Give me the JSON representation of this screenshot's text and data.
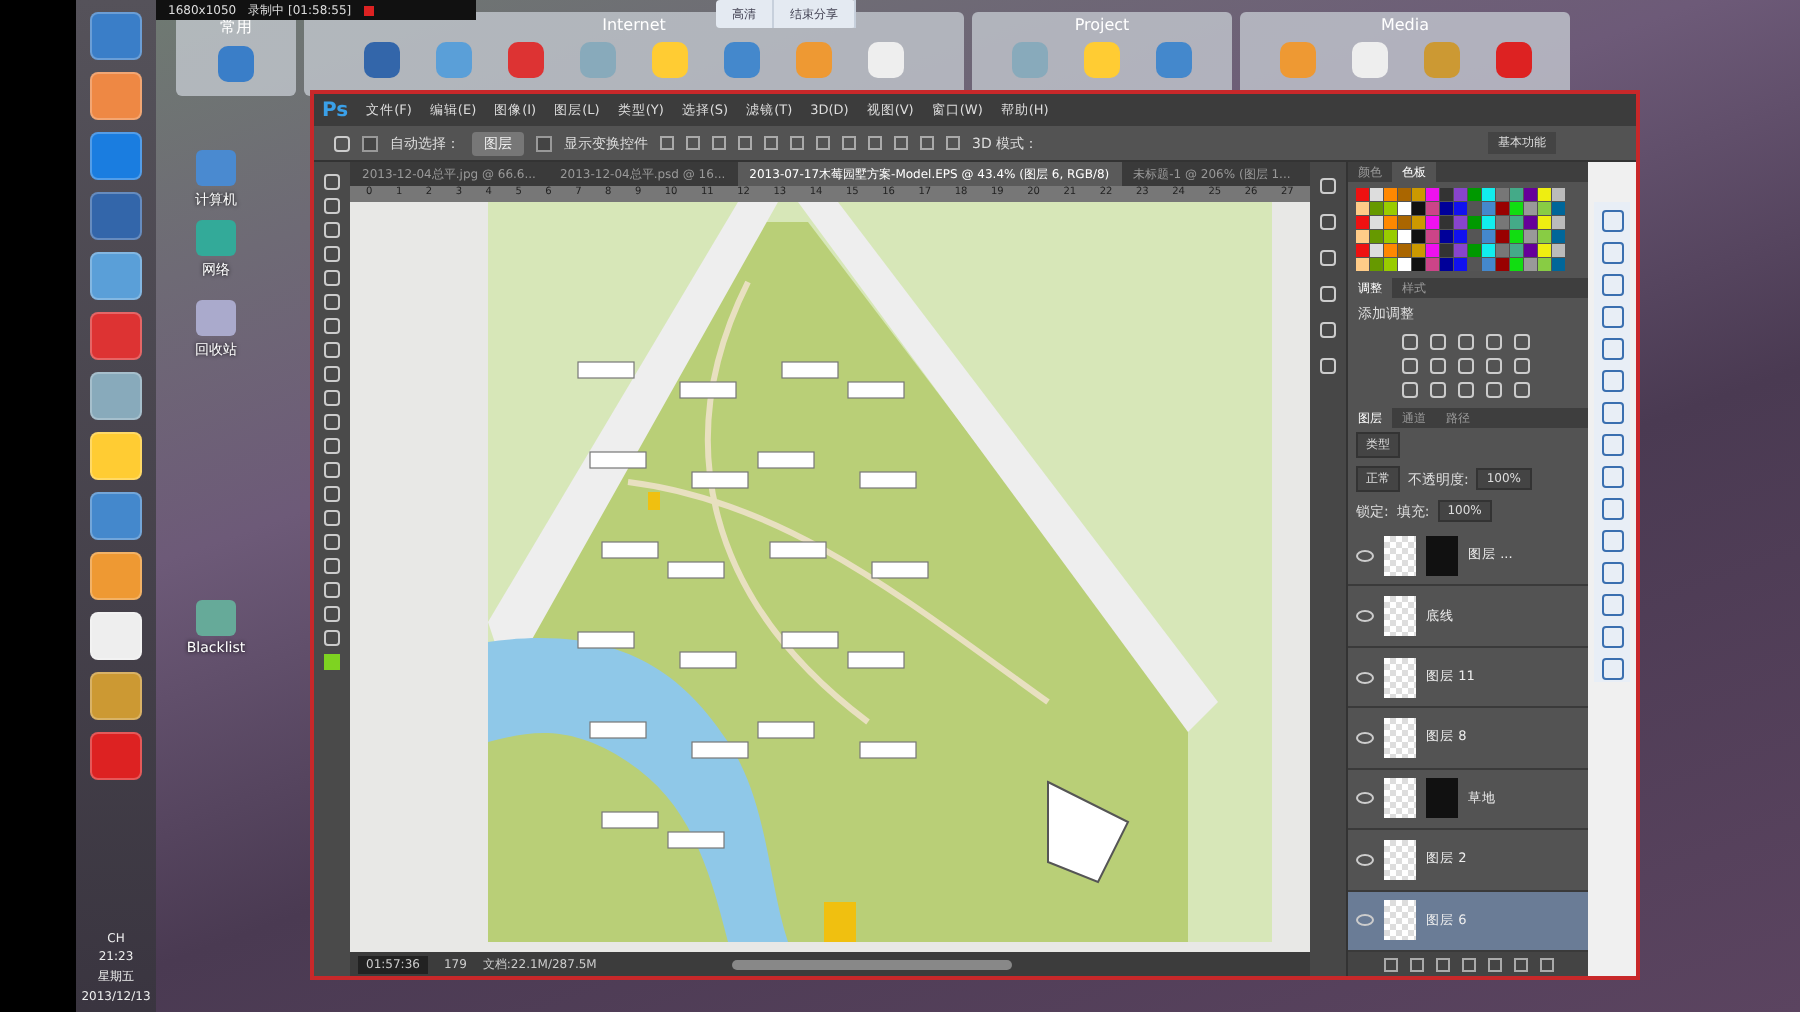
{
  "recorder": {
    "resolution": "1680x1050",
    "status": "录制中 [01:58:55]"
  },
  "share_bar": {
    "buttons": [
      "高清",
      "结束分享"
    ]
  },
  "launcher": {
    "groups": [
      {
        "title": "常用"
      },
      {
        "title": "Internet"
      },
      {
        "title": "Project"
      },
      {
        "title": "Media"
      }
    ]
  },
  "desktop_icons": [
    {
      "label": "计算机"
    },
    {
      "label": "网络"
    },
    {
      "label": "回收站"
    },
    {
      "label": "Blacklist"
    }
  ],
  "taskbar": {
    "language": "CH",
    "time": "21:23",
    "weekday": "星期五",
    "date": "2013/12/13"
  },
  "photoshop": {
    "logo": "Ps",
    "menu": [
      "文件(F)",
      "编辑(E)",
      "图像(I)",
      "图层(L)",
      "类型(Y)",
      "选择(S)",
      "滤镜(T)",
      "3D(D)",
      "视图(V)",
      "窗口(W)",
      "帮助(H)"
    ],
    "options": {
      "auto_select": {
        "label": "自动选择：",
        "checked": false
      },
      "target": "图层",
      "show_transform": {
        "label": "显示变换控件",
        "checked": false
      },
      "mode_3d": "3D 模式：",
      "workspace": "基本功能"
    },
    "tabs": [
      {
        "label": "2013-12-04总平.jpg @ 66.6...",
        "selected": false
      },
      {
        "label": "2013-12-04总平.psd @ 16...",
        "selected": false
      },
      {
        "label": "2013-07-17木莓园墅方案-Model.EPS @ 43.4% (图层 6, RGB/8)",
        "selected": true
      },
      {
        "label": "未标题-1 @ 206% (图层 1...",
        "selected": false
      }
    ],
    "ruler": [
      "0",
      "1",
      "2",
      "3",
      "4",
      "5",
      "6",
      "7",
      "8",
      "9",
      "10",
      "11",
      "12",
      "13",
      "14",
      "15",
      "16",
      "17",
      "18",
      "19",
      "20",
      "21",
      "22",
      "23",
      "24",
      "25",
      "26",
      "27"
    ],
    "swatches_panel": {
      "tabs": [
        {
          "label": "颜色",
          "selected": false
        },
        {
          "label": "色板",
          "selected": true
        }
      ]
    },
    "adjustments_panel": {
      "tabs": [
        {
          "label": "调整",
          "selected": true
        },
        {
          "label": "样式",
          "selected": false
        }
      ],
      "heading": "添加调整"
    },
    "layers_panel": {
      "tabs": [
        {
          "label": "图层",
          "selected": true
        },
        {
          "label": "通道",
          "selected": false
        },
        {
          "label": "路径",
          "selected": false
        }
      ],
      "filter": "类型",
      "blend_mode": "正常",
      "opacity_label": "不透明度:",
      "opacity": "100%",
      "lock_label": "锁定:",
      "fill_label": "填充:",
      "fill": "100%",
      "layers": [
        {
          "name": "图层 ...",
          "kind": "masked",
          "visible": true,
          "selected": false
        },
        {
          "name": "底线",
          "kind": "plain",
          "visible": true,
          "selected": false
        },
        {
          "name": "图层 11",
          "kind": "plain",
          "visible": true,
          "selected": false
        },
        {
          "name": "图层 8",
          "kind": "plain",
          "visible": true,
          "selected": false
        },
        {
          "name": "草地",
          "kind": "masked",
          "visible": true,
          "selected": false
        },
        {
          "name": "图层 2",
          "kind": "plain",
          "visible": true,
          "selected": false
        },
        {
          "name": "图层 6",
          "kind": "plain",
          "visible": true,
          "selected": true
        }
      ]
    },
    "status_bar": {
      "timer": "01:57:36",
      "count": "179",
      "document": "文档:22.1M/287.5M"
    }
  }
}
